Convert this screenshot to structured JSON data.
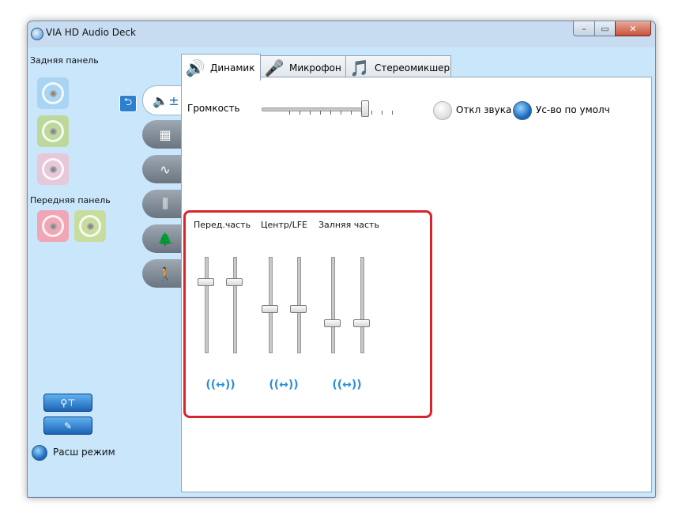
{
  "window": {
    "title": "VIA HD Audio Deck",
    "controls": {
      "minimize": "–",
      "maximize": "▭",
      "close": "✕"
    }
  },
  "left_panel": {
    "rear_title": "Задняя панель",
    "rear_jacks": [
      {
        "color": "#a9d4f2",
        "name": "blue"
      },
      {
        "color": "#bcd89a",
        "name": "green"
      },
      {
        "color": "#e6c8d8",
        "name": "pink"
      }
    ],
    "front_title": "Передняя панель",
    "front_jacks": [
      {
        "color": "#f0a6b4",
        "name": "pink"
      },
      {
        "color": "#c8dc9e",
        "name": "green"
      }
    ],
    "advanced_label": "Расш режим"
  },
  "tabs": [
    {
      "label": "Динамик",
      "icon": "speaker-icon",
      "active": true
    },
    {
      "label": "Микрофон",
      "icon": "microphone-icon",
      "active": false
    },
    {
      "label": "Стереомикшер",
      "icon": "music-icon",
      "active": false
    }
  ],
  "volume": {
    "label": "Громкость",
    "value_fraction": 0.74
  },
  "mute": {
    "label": "Откл звука",
    "checked": false
  },
  "default_device": {
    "label": "Ус-во по умолч",
    "checked": true
  },
  "channels": [
    {
      "label": "Перед.часть",
      "left_level": 0.73,
      "right_level": 0.73
    },
    {
      "label": "Центр/LFE",
      "left_level": 0.45,
      "right_level": 0.45
    },
    {
      "label": "Залняя часть",
      "left_level": 0.3,
      "right_level": 0.3
    }
  ],
  "link_symbol": "((↔))",
  "colors": {
    "highlight_border": "#d8252d",
    "accent": "#1e6fc2",
    "client_bg": "#cae6fb"
  }
}
